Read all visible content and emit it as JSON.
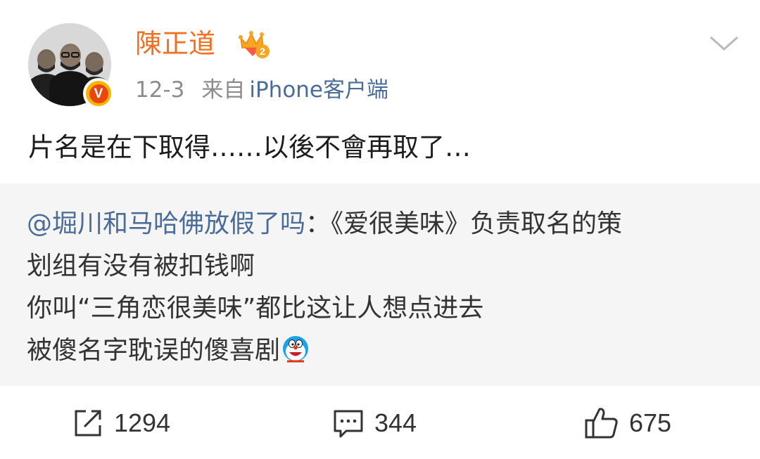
{
  "header": {
    "username": "陳正道",
    "date": "12-3",
    "source_prefix": "来自",
    "source_link": "iPhone客户端",
    "verified_letter": "V",
    "crown_level": "2"
  },
  "post": {
    "text": "片名是在下取得……以後不會再取了…"
  },
  "retweet": {
    "mention": "@堀川和马哈佛放假了吗",
    "separator": "：",
    "line1_rest": "《爱很美味》负责取名的策",
    "line2": "划组有没有被扣钱啊",
    "line3": "你叫“三角恋很美味”都比这让人想点进去",
    "line4": "被傻名字耽误的傻喜剧",
    "emoji": "doraemon-icon"
  },
  "actions": {
    "repost_count": "1294",
    "comment_count": "344",
    "like_count": "675"
  },
  "colors": {
    "username": "#f2701f",
    "link": "#4a6c98",
    "meta": "#8c8c8c",
    "retweet_bg": "#f5f5f5",
    "badge_outer": "#f7b500",
    "badge_inner": "#e8470f"
  }
}
